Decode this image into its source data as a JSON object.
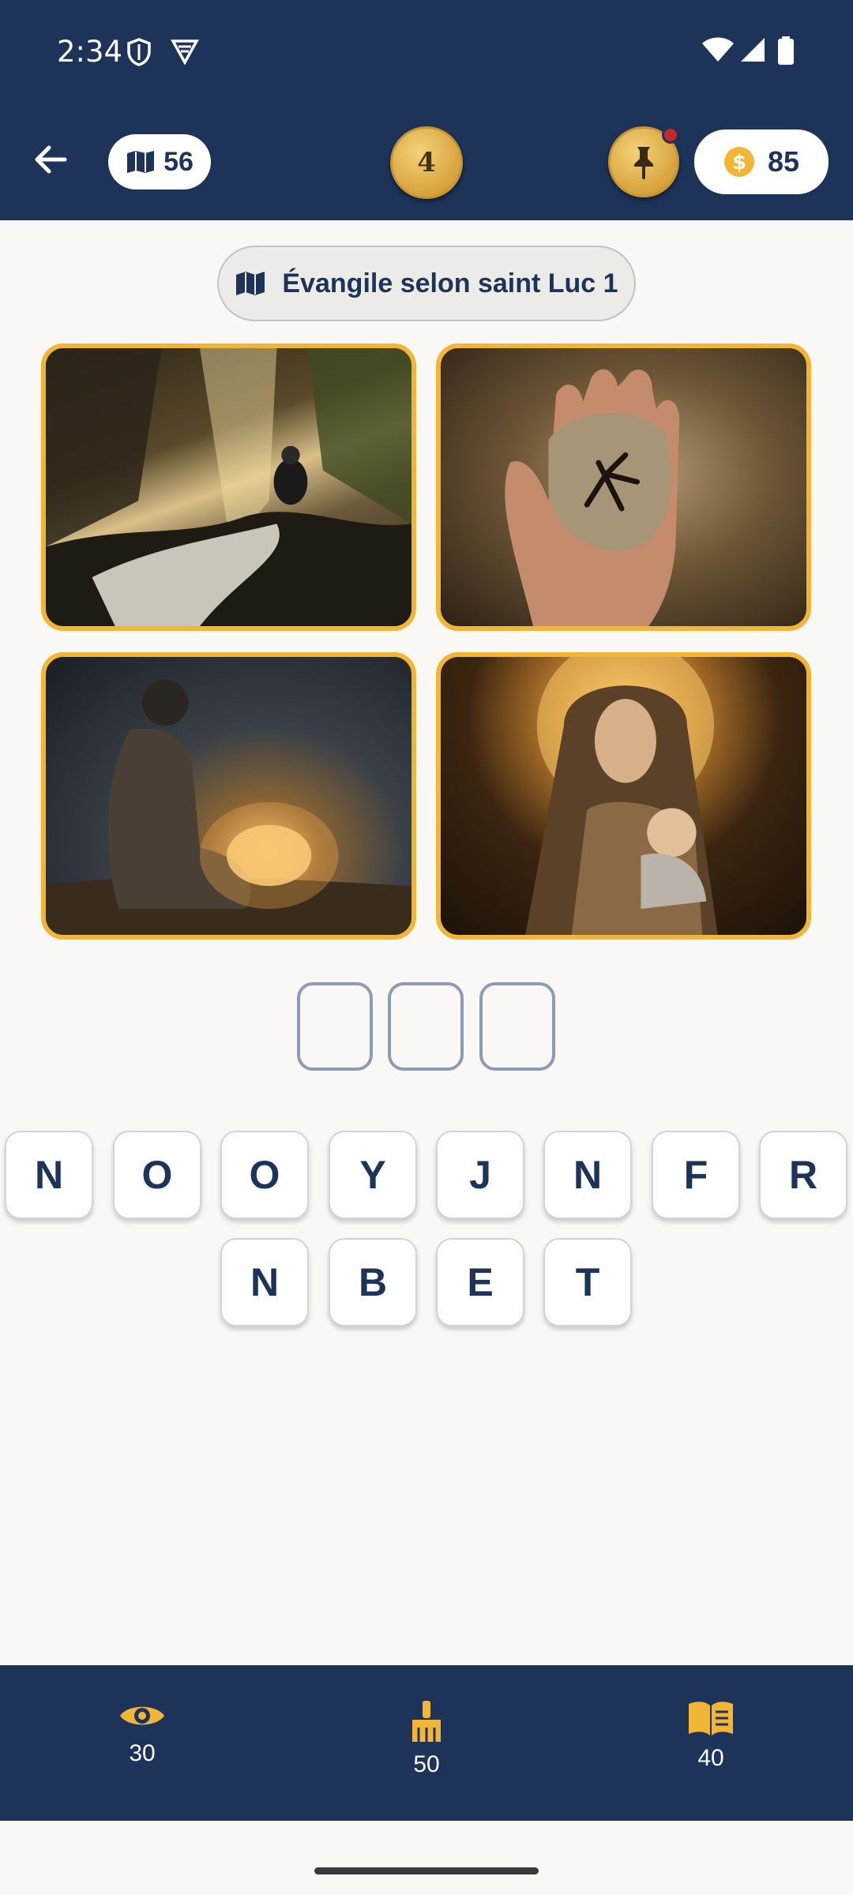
{
  "status_bar": {
    "time": "2:34"
  },
  "header": {
    "book_count": "56",
    "level": "4",
    "coins": "85"
  },
  "chapter": {
    "title": "Évangile selon saint Luc 1"
  },
  "answer": {
    "slots": [
      "",
      "",
      ""
    ]
  },
  "letters": {
    "row1": [
      "N",
      "O",
      "O",
      "Y",
      "J",
      "N",
      "F",
      "R"
    ],
    "row2": [
      "N",
      "B",
      "E",
      "T"
    ]
  },
  "tools": {
    "reveal": {
      "icon": "eye-icon",
      "cost": "30"
    },
    "remove": {
      "icon": "broom-icon",
      "cost": "50"
    },
    "solve": {
      "icon": "open-book-icon",
      "cost": "40"
    }
  },
  "colors": {
    "navy": "#1d3359",
    "gold": "#f2b536",
    "background": "#faf8f4"
  }
}
